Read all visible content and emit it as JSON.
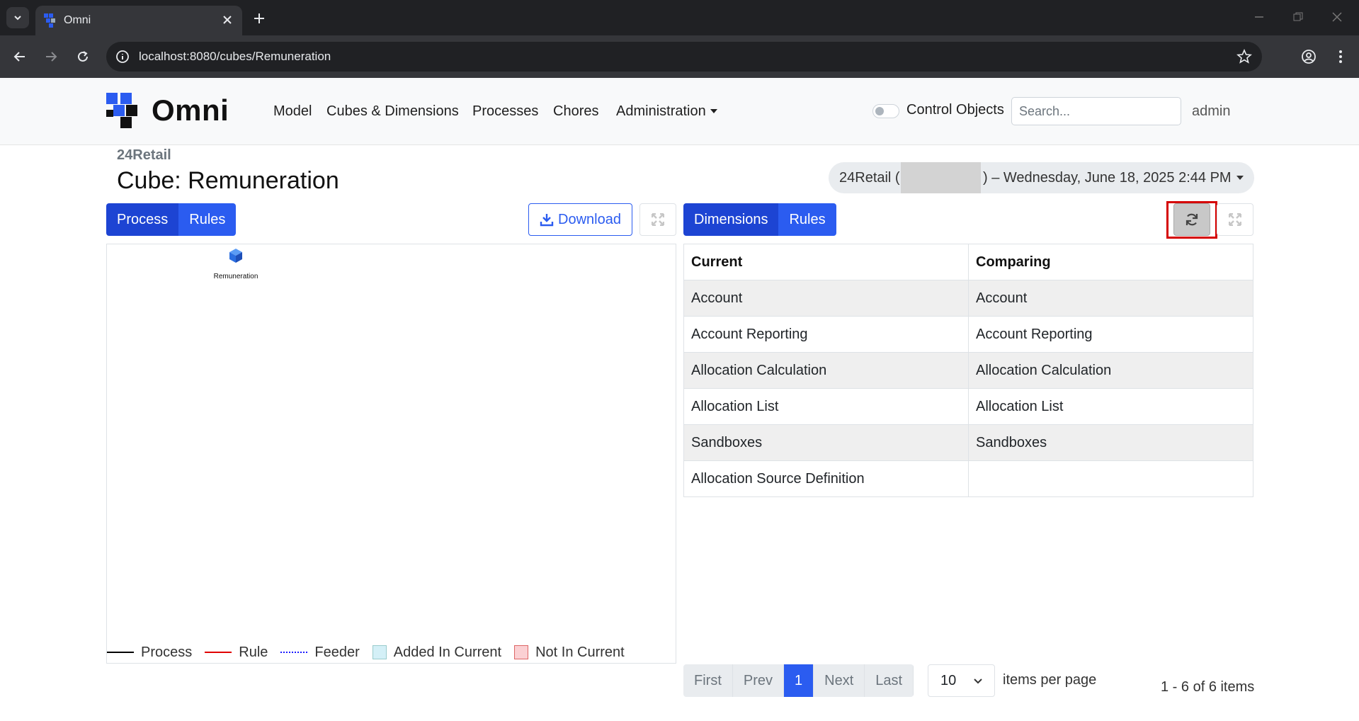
{
  "browser": {
    "tab_title": "Omni",
    "url": "localhost:8080/cubes/Remuneration"
  },
  "navbar": {
    "brand": "Omni",
    "links": [
      "Model",
      "Cubes & Dimensions",
      "Processes",
      "Chores",
      "Administration"
    ],
    "control_objects_label": "Control Objects",
    "control_objects_on": false,
    "search_placeholder": "Search...",
    "user": "admin"
  },
  "header": {
    "breadcrumb": "24Retail",
    "title": "Cube: Remuneration",
    "context_prefix": "24Retail (",
    "context_suffix": ") – Wednesday, June 18, 2025 2:44 PM"
  },
  "left_panel": {
    "tabs": [
      "Process",
      "Rules"
    ],
    "download_label": "Download",
    "node_label": "Remuneration",
    "legend": [
      {
        "label": "Process",
        "kind": "line",
        "color": "#000000",
        "style": "solid"
      },
      {
        "label": "Rule",
        "kind": "line",
        "color": "#e00000",
        "style": "solid"
      },
      {
        "label": "Feeder",
        "kind": "line",
        "color": "#1a1aff",
        "style": "dotted"
      },
      {
        "label": "Added In Current",
        "kind": "box",
        "color": "#d4f0f7"
      },
      {
        "label": "Not In Current",
        "kind": "box",
        "color": "#fbd0d3"
      }
    ]
  },
  "right_panel": {
    "tabs": [
      "Dimensions",
      "Rules"
    ],
    "columns": [
      "Current",
      "Comparing"
    ],
    "rows": [
      [
        "Account",
        "Account"
      ],
      [
        "Account Reporting",
        "Account Reporting"
      ],
      [
        "Allocation Calculation",
        "Allocation Calculation"
      ],
      [
        "Allocation List",
        "Allocation List"
      ],
      [
        "Sandboxes",
        "Sandboxes"
      ],
      [
        "Allocation Source Definition",
        ""
      ]
    ],
    "pager": {
      "first": "First",
      "prev": "Prev",
      "current": "1",
      "next": "Next",
      "last": "Last",
      "per_page": "10",
      "per_page_label": "items per page",
      "range": "1 - 6 of 6 items"
    }
  },
  "colors": {
    "primary": "#2b5cf0",
    "primary_active": "#1d44d3",
    "highlight": "#d50000"
  }
}
